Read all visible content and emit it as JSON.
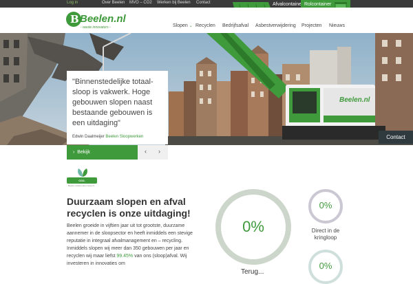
{
  "topbar": {
    "login": "Log in",
    "links": [
      "Over Beelen",
      "MVO – CO2",
      "Werken bij Beelen",
      "Contact"
    ]
  },
  "promo": {
    "afval": "Afvalcontainer\nbestellen ››",
    "rol": "Rolcontainer\nbedrijfsafval ››"
  },
  "logo": {
    "name": "Beelen.nl",
    "mark": "B",
    "tagline": "- waste innovators -"
  },
  "nav": [
    "Slopen",
    "Recyclen",
    "Bedrijfsafval",
    "Asbestverwijdering",
    "Projecten",
    "Nieuws"
  ],
  "hero": {
    "quote": "\"Binnenstedelijke totaal-sloop is vakwerk. Hoge gebouwen slopen naast bestaande gebouwen is een uitdaging\"",
    "author": "Edwin Daalmeijer",
    "company": "Beelen Sloopwerken",
    "machine_label": "Beelen.nl",
    "cta": "Bekijk",
    "prev": "‹",
    "next": "›",
    "contact": "Contact"
  },
  "badge": {
    "label": "CO2-PRESTATIELADDER",
    "sub": "Beelen voldoet aan niveau 5"
  },
  "main": {
    "heading": "Duurzaam slopen en afval recyclen is onze uitdaging!",
    "body_1": "Beelen groeide in vijftien jaar uit tot grootste, duurzame aannemer in de sloopsector en heeft inmiddels een stevige reputatie in integraal afvalmanagement en – recycling. Inmiddels slopen wij meer dan 350 gebouwen per jaar en recyclen wij maar liefst",
    "body_hl": "99.45%",
    "body_2": "van ons (sloop)afval. Wij investeren in innovaties om"
  },
  "stats": {
    "big": {
      "value": "0%",
      "label": "Terug..."
    },
    "small1": {
      "value": "0%",
      "label": "Direct in de kringloop"
    },
    "small2": {
      "value": "0%"
    }
  },
  "colors": {
    "brand_green": "#3f9a3c",
    "dark": "#2f3a3f"
  }
}
